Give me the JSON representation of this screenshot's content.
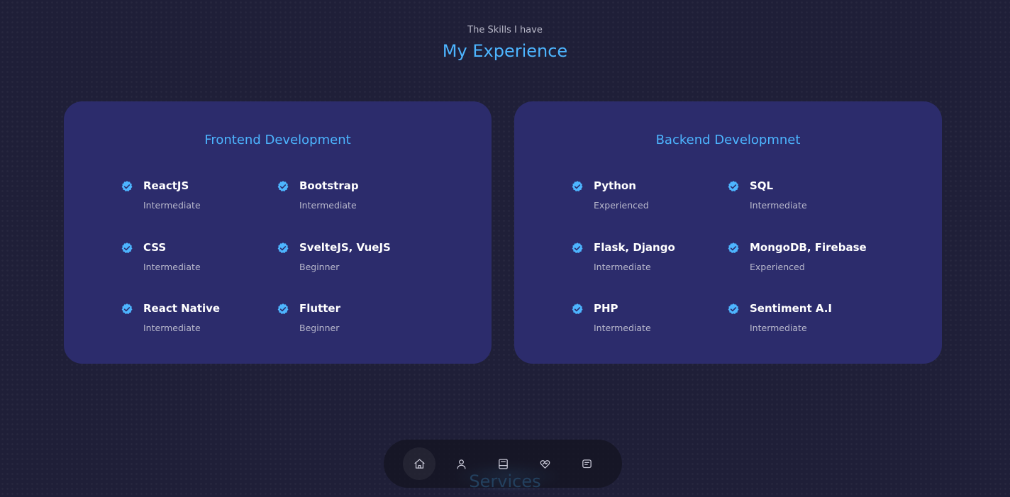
{
  "header": {
    "subtitle": "The Skills I have",
    "title": "My Experience"
  },
  "frontend": {
    "title": "Frontend Development",
    "skills": [
      {
        "name": "ReactJS",
        "level": "Intermediate"
      },
      {
        "name": "Bootstrap",
        "level": "Intermediate"
      },
      {
        "name": "CSS",
        "level": "Intermediate"
      },
      {
        "name": "SvelteJS, VueJS",
        "level": "Beginner"
      },
      {
        "name": "React Native",
        "level": "Intermediate"
      },
      {
        "name": "Flutter",
        "level": "Beginner"
      }
    ]
  },
  "backend": {
    "title": "Backend Developmnet",
    "skills": [
      {
        "name": "Python",
        "level": "Experienced"
      },
      {
        "name": "SQL",
        "level": "Intermediate"
      },
      {
        "name": "Flask, Django",
        "level": "Intermediate"
      },
      {
        "name": "MongoDB, Firebase",
        "level": "Experienced"
      },
      {
        "name": "PHP",
        "level": "Intermediate"
      },
      {
        "name": "Sentiment A.I",
        "level": "Intermediate"
      }
    ]
  },
  "next_section": {
    "title_peek": "Services"
  },
  "nav": {
    "items": [
      {
        "icon": "home-icon",
        "active": true
      },
      {
        "icon": "user-icon",
        "active": false
      },
      {
        "icon": "book-icon",
        "active": false
      },
      {
        "icon": "handshake-icon",
        "active": false
      },
      {
        "icon": "message-icon",
        "active": false
      }
    ]
  },
  "colors": {
    "background": "#1f1f38",
    "card": "#2c2c6c",
    "accent": "#4db5ff",
    "text": "#ffffff",
    "muted": "#b8b8cc"
  }
}
